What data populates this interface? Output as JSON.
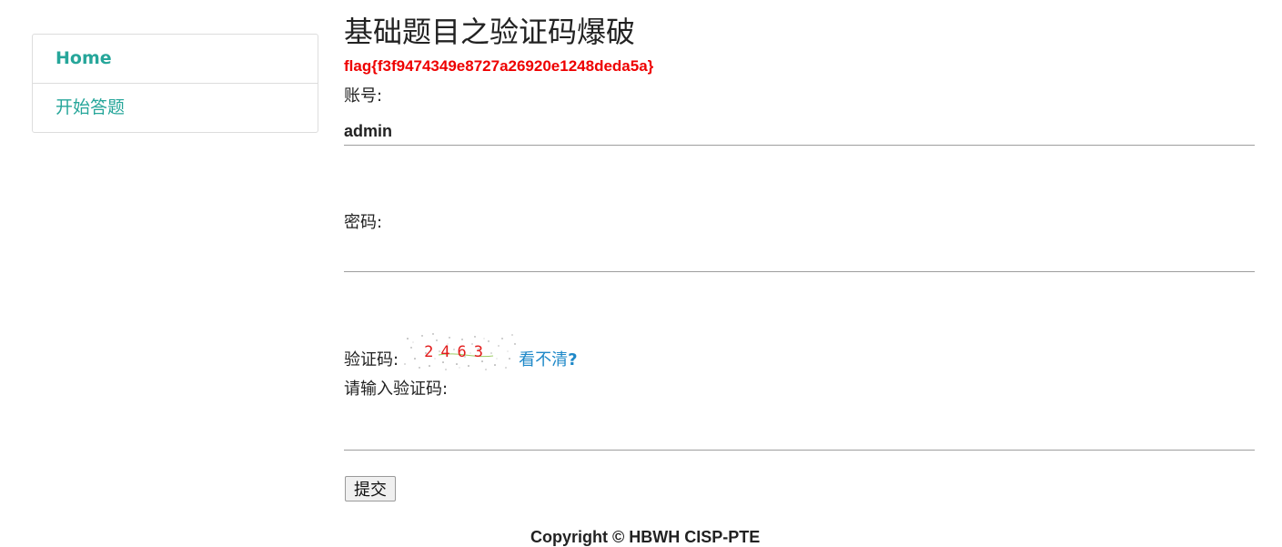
{
  "sidebar": {
    "items": [
      {
        "label": "Home",
        "active": true
      },
      {
        "label": "开始答题",
        "active": false
      }
    ]
  },
  "page": {
    "title": "基础题目之验证码爆破",
    "flag": "flag{f3f9474349e8727a26920e1248deda5a}"
  },
  "form": {
    "username_label": "账号:",
    "username_value": "admin",
    "password_label": "密码:",
    "password_value": "",
    "captcha_label": "验证码:",
    "captcha_text": "2463",
    "captcha_refresh_label": "看不清",
    "captcha_refresh_q": "?",
    "captcha_input_label": "请输入验证码:",
    "captcha_input_value": "",
    "submit_label": "提交"
  },
  "footer": {
    "copyright": "Copyright © HBWH CISP-PTE"
  },
  "colors": {
    "accent": "#26a69a",
    "flag": "#ee0000",
    "link": "#1e88c8"
  }
}
